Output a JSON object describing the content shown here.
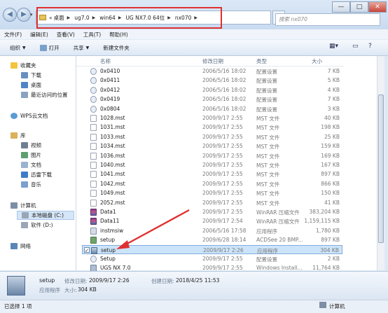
{
  "address": {
    "crumbs": [
      "«",
      "桌面",
      "ug7.0",
      "win64",
      "UG NX7.0 64位",
      "nx070"
    ],
    "search_placeholder": "搜索 nx070"
  },
  "window_controls": {
    "minimize": "—",
    "maximize": "□",
    "close": "✕"
  },
  "menu": [
    "文件(F)",
    "编辑(E)",
    "查看(V)",
    "工具(T)",
    "帮助(H)"
  ],
  "toolbar": {
    "organize": "组织",
    "open": "打开",
    "share": "共享",
    "new_folder": "新建文件夹"
  },
  "nav": {
    "favorites": "收藏夹",
    "downloads": "下载",
    "desktop": "桌面",
    "recent": "最近访问的位置",
    "wps": "WPS云文档",
    "libraries": "库",
    "videos": "视频",
    "pictures": "图片",
    "documents": "文档",
    "xunlei": "迅雷下载",
    "music": "音乐",
    "computer": "计算机",
    "local_c": "本地磁盘 (C:)",
    "soft_d": "软件 (D:)",
    "network": "网络"
  },
  "columns": {
    "name": "名称",
    "date": "修改日期",
    "type": "类型",
    "size": "大小"
  },
  "files": [
    {
      "name": "0x0410",
      "date": "2006/5/16 18:02",
      "type": "配置设置",
      "size": "7 KB",
      "icon": "config-icon"
    },
    {
      "name": "0x0411",
      "date": "2006/5/16 18:02",
      "type": "配置设置",
      "size": "5 KB",
      "icon": "config-icon"
    },
    {
      "name": "0x0412",
      "date": "2006/5/16 18:02",
      "type": "配置设置",
      "size": "4 KB",
      "icon": "config-icon"
    },
    {
      "name": "0x0419",
      "date": "2006/5/16 18:02",
      "type": "配置设置",
      "size": "7 KB",
      "icon": "config-icon"
    },
    {
      "name": "0x0804",
      "date": "2006/5/16 18:02",
      "type": "配置设置",
      "size": "3 KB",
      "icon": "config-icon"
    },
    {
      "name": "1028.mst",
      "date": "2009/9/17 2:55",
      "type": "MST 文件",
      "size": "40 KB",
      "icon": "file-icon"
    },
    {
      "name": "1031.mst",
      "date": "2009/9/17 2:55",
      "type": "MST 文件",
      "size": "198 KB",
      "icon": "file-icon"
    },
    {
      "name": "1033.mst",
      "date": "2009/9/17 2:55",
      "type": "MST 文件",
      "size": "25 KB",
      "icon": "file-icon"
    },
    {
      "name": "1034.mst",
      "date": "2009/9/17 2:55",
      "type": "MST 文件",
      "size": "159 KB",
      "icon": "file-icon"
    },
    {
      "name": "1036.mst",
      "date": "2009/9/17 2:55",
      "type": "MST 文件",
      "size": "169 KB",
      "icon": "file-icon"
    },
    {
      "name": "1040.mst",
      "date": "2009/9/17 2:55",
      "type": "MST 文件",
      "size": "167 KB",
      "icon": "file-icon"
    },
    {
      "name": "1041.mst",
      "date": "2009/9/17 2:55",
      "type": "MST 文件",
      "size": "897 KB",
      "icon": "file-icon"
    },
    {
      "name": "1042.mst",
      "date": "2009/9/17 2:55",
      "type": "MST 文件",
      "size": "866 KB",
      "icon": "file-icon"
    },
    {
      "name": "1049.mst",
      "date": "2009/9/17 2:55",
      "type": "MST 文件",
      "size": "150 KB",
      "icon": "file-icon"
    },
    {
      "name": "2052.mst",
      "date": "2009/9/17 2:55",
      "type": "MST 文件",
      "size": "41 KB",
      "icon": "file-icon"
    },
    {
      "name": "Data1",
      "date": "2009/9/17 2:55",
      "type": "WinRAR 压缩文件",
      "size": "383,204 KB",
      "icon": "rar-icon"
    },
    {
      "name": "Data11",
      "date": "2009/9/17 2:54",
      "type": "WinRAR 压缩文件",
      "size": "1,159,115 KB",
      "icon": "rar-icon"
    },
    {
      "name": "instmsiw",
      "date": "2006/5/16 17:58",
      "type": "应用程序",
      "size": "1,780 KB",
      "icon": "app-icon"
    },
    {
      "name": "setup",
      "date": "2009/6/28 18:14",
      "type": "ACDSee 20 BMP...",
      "size": "897 KB",
      "icon": "image-icon"
    },
    {
      "name": "setup",
      "date": "2009/9/17 2:26",
      "type": "应用程序",
      "size": "304 KB",
      "icon": "setup-icon",
      "selected": true
    },
    {
      "name": "Setup",
      "date": "2009/9/17 2:55",
      "type": "配置设置",
      "size": "2 KB",
      "icon": "config-icon"
    },
    {
      "name": "UGS NX 7.0",
      "date": "2009/9/17 2:55",
      "type": "Windows Install...",
      "size": "11,764 KB",
      "icon": "msi-icon"
    }
  ],
  "details": {
    "name": "setup",
    "modified_label": "修改日期:",
    "modified_value": "2009/9/17 2:26",
    "created_label": "创建日期:",
    "created_value": "2018/4/25 11:53",
    "type": "应用程序",
    "size_label": "大小:",
    "size_value": "304 KB"
  },
  "status": {
    "selected": "已选择 1 项",
    "location": "计算机"
  },
  "colors": {
    "annotation_red": "#e03030",
    "selection_blue": "#cce4f9"
  }
}
